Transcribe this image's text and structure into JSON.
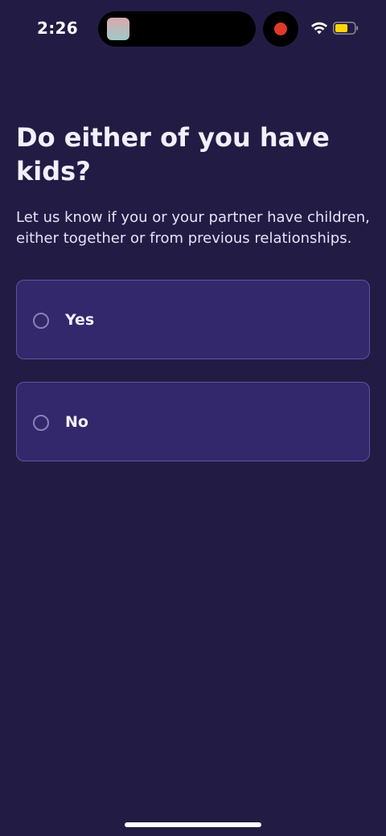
{
  "status_bar": {
    "time": "2:26"
  },
  "question": {
    "title": "Do either of you have kids?",
    "subtitle": "Let us know if you or your partner have children, either together or from previous relationships."
  },
  "options": [
    {
      "label": "Yes",
      "selected": false
    },
    {
      "label": "No",
      "selected": false
    }
  ],
  "colors": {
    "background": "#221c45",
    "card": "#33286b",
    "card_border": "#5e52a0",
    "record": "#e0392b",
    "battery": "#ffd60a"
  }
}
